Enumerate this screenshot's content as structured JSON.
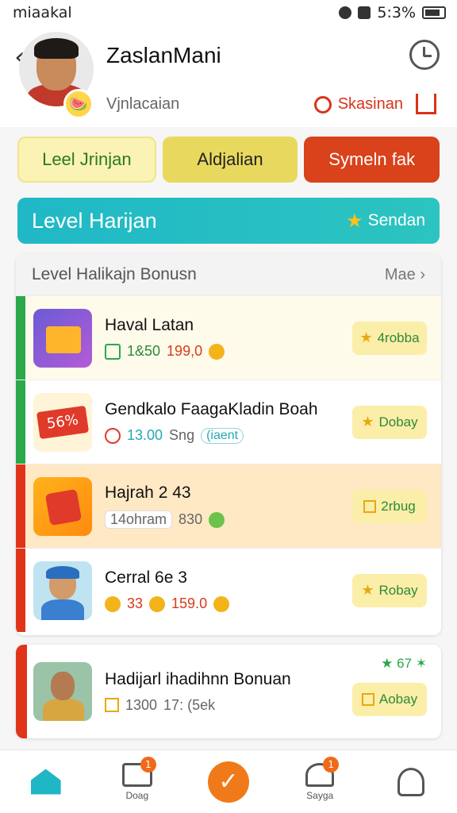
{
  "status_bar": {
    "carrier": "miaakal",
    "battery": "5:3%"
  },
  "header": {
    "name": "ZaslanMani",
    "subtitle": "Vjnlacaian",
    "action_link": "Skasinan"
  },
  "tabs": [
    "Leel Jrinjan",
    "Aldjalian",
    "Symeln fak"
  ],
  "banner": {
    "title": "Level Harijan",
    "right_label": "Sendan"
  },
  "list": {
    "header_title": "Level Halikajn Bonusn",
    "more_label": "Mae",
    "items": [
      {
        "title": "Haval Latan",
        "meta_a": "1&50",
        "meta_b": "199,0",
        "action": "4robba",
        "bar_color": "#2aa84a"
      },
      {
        "title": "Gendkalo FaagaKladin Boah",
        "meta_a": "13.00",
        "meta_b": "Sng",
        "meta_c": "(iaent",
        "action": "Dobay",
        "bar_color": "#2aa84a"
      },
      {
        "title": "Hajrah 2 43",
        "meta_a": "14ohram",
        "meta_b": "830",
        "action": "2rbug",
        "bar_color": "#e0341a"
      },
      {
        "title": "Cerral 6e 3",
        "meta_a": "33",
        "meta_b": "159.0",
        "action": "Robay",
        "bar_color": "#e0341a"
      }
    ]
  },
  "card": {
    "title": "Hadijarl ihadihnn Bonuan",
    "meta_a": "1300",
    "meta_b": "17: (5ek",
    "note": "67",
    "action": "Aobay"
  },
  "nav": {
    "items": [
      {
        "icon": "home-icon",
        "label": ""
      },
      {
        "icon": "bag-icon",
        "label": "Doag",
        "badge": "1"
      },
      {
        "icon": "check-icon",
        "label": ""
      },
      {
        "icon": "gift-icon",
        "label": "Sayga",
        "badge": "1"
      },
      {
        "icon": "user-icon",
        "label": ""
      }
    ]
  },
  "colors": {
    "accent_teal": "#1fb6c6",
    "accent_red": "#d9421a",
    "accent_yellow": "#e8d95e"
  }
}
